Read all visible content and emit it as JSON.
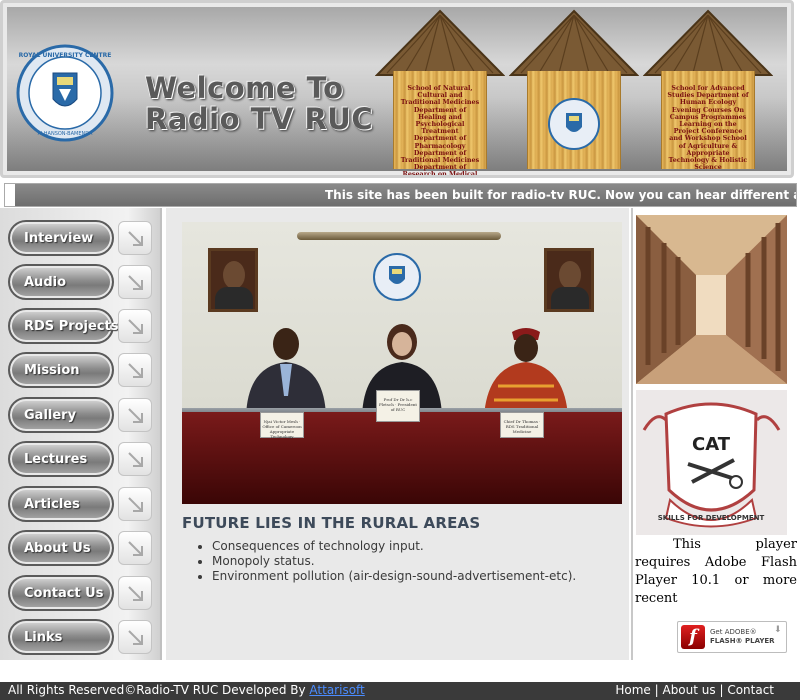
{
  "header": {
    "welcome_line1": "Welcome To",
    "welcome_line2": "Radio TV RUC",
    "logo_text": "ROYAL UNIVERSITY CENTRE · ALHANSON-BAMENDA CAMEROON",
    "hut_signs": [
      "School of Natural, Cultural and Traditional Medicines Department of Healing and Psychological Treatment Department of Pharmacology Department of Traditional Medicines Department of Research on Medical Plants and Medical Creatures Department of Botanical Gardens",
      "",
      "School for Advanced Studies Department of Human Ecology Evening Courses On Campus Programmes Learning on the Project Conference and Workshop School of Agriculture & Appropriate Technology & Holistic Science"
    ]
  },
  "marquee": {
    "text": "This site has been built for radio-tv RUC. Now you can hear different audios on our online"
  },
  "nav": {
    "items": [
      {
        "label": "Interview"
      },
      {
        "label": "Audio"
      },
      {
        "label": "RDS Projects"
      },
      {
        "label": "Mission"
      },
      {
        "label": "Gallery"
      },
      {
        "label": "Lectures"
      },
      {
        "label": "Articles"
      },
      {
        "label": "About Us"
      },
      {
        "label": "Contact Us"
      },
      {
        "label": "Links"
      }
    ]
  },
  "main": {
    "name_cards": [
      "Njai Victor Mesh · Office of Cameroon Appropriate Technology",
      "Prof Dr Dr h.c Pletsch · President of RUC",
      "Chief Dr Thomas · RDS Traditional Medicine"
    ],
    "headline": "FUTURE LIES IN THE RURAL AREAS",
    "bullets": [
      "Consequences of technology input.",
      "Monopoly status.",
      "Environment pollution (air-design-sound-advertisement-etc)."
    ]
  },
  "right": {
    "cat_text": "CAT",
    "cat_motto": "SKILLS FOR DEVELOPMENT",
    "flash_message": "This player requires Adobe Flash Player 10.1 or more recent",
    "flash_badge_line1": "Get ADOBE®",
    "flash_badge_line2": "FLASH® PLAYER"
  },
  "footer": {
    "rights_text": "All Rights Reserved©Radio-TV RUC Developed By ",
    "developer_link": "Attarisoft",
    "links": [
      "Home",
      "About us",
      "Contact"
    ],
    "separator": " | "
  },
  "colors": {
    "nav_button": "#8d8d8d",
    "headline": "#3d4a5a",
    "footer_bg": "#3a3a3a",
    "developer_link": "#4a8cff"
  }
}
